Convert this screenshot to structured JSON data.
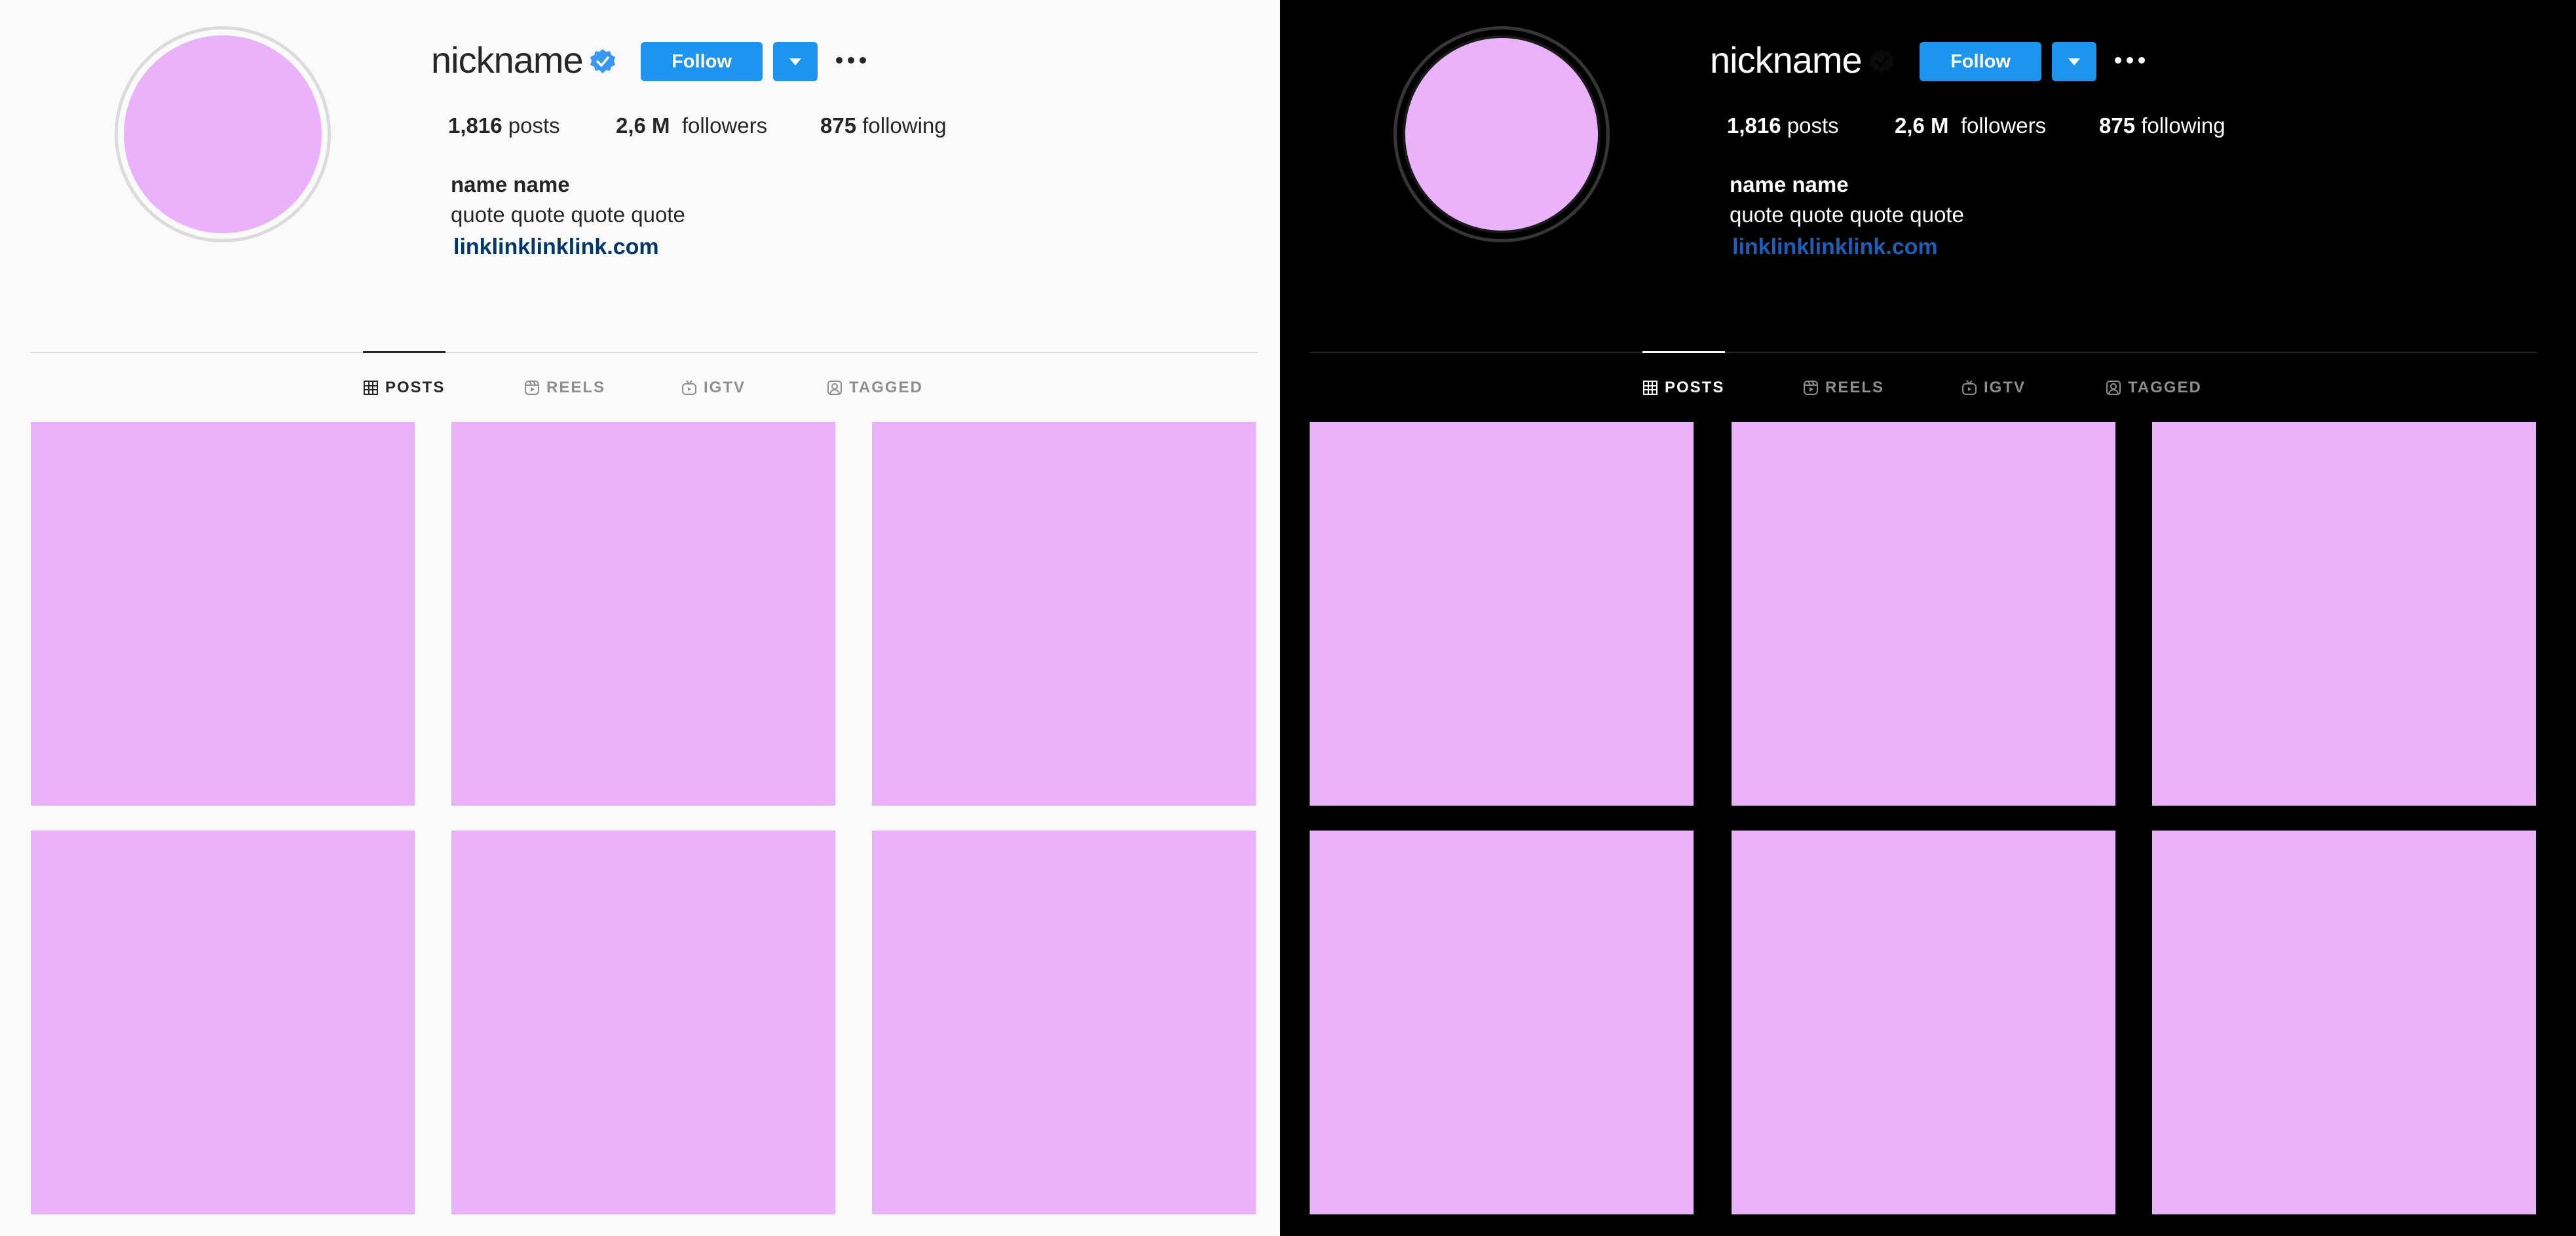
{
  "profile": {
    "username": "nickname",
    "follow_label": "Follow",
    "stats": {
      "posts_count": "1,816",
      "posts_label": "posts",
      "followers_count": "2,6 M",
      "followers_label": "followers",
      "following_count": "875",
      "following_label": "following"
    },
    "full_name": "name name",
    "bio": "quote quote quote quote",
    "website": "linklinklinklink.com"
  },
  "tabs": [
    {
      "label": "POSTS",
      "icon": "grid-icon",
      "active": true
    },
    {
      "label": "REELS",
      "icon": "reels-icon",
      "active": false
    },
    {
      "label": "IGTV",
      "icon": "igtv-icon",
      "active": false
    },
    {
      "label": "TAGGED",
      "icon": "tagged-icon",
      "active": false
    }
  ],
  "themes": [
    {
      "name": "light",
      "background": "#fafafa",
      "text": "#262626"
    },
    {
      "name": "dark",
      "background": "#000000",
      "text": "#ffffff"
    }
  ],
  "colors": {
    "accent": "#1b95f0",
    "placeholder": "#e9b2fb",
    "verified": "#3897f0"
  },
  "posts_visible": 6
}
